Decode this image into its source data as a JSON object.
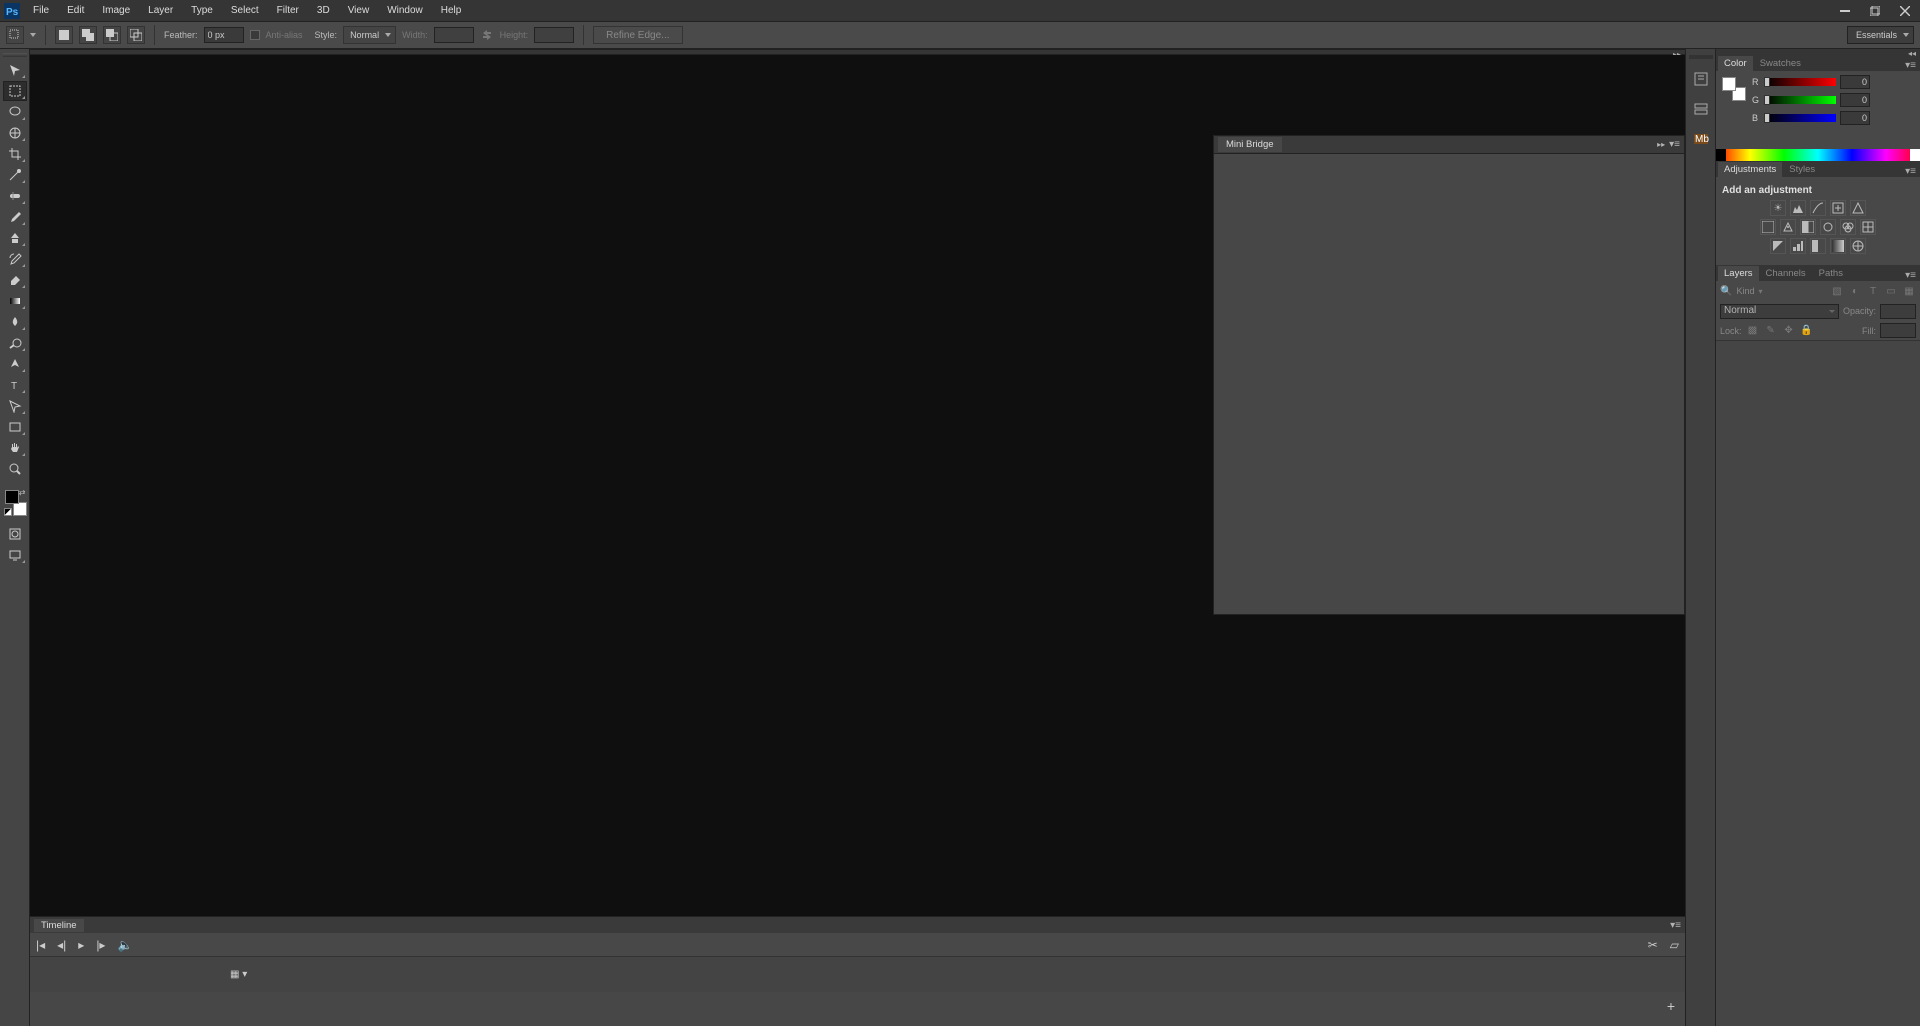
{
  "menu": {
    "file": "File",
    "edit": "Edit",
    "image": "Image",
    "layer": "Layer",
    "type": "Type",
    "select": "Select",
    "filter": "Filter",
    "threeD": "3D",
    "view": "View",
    "window": "Window",
    "help": "Help"
  },
  "options": {
    "feather_label": "Feather:",
    "feather_value": "0 px",
    "antialias_label": "Anti-alias",
    "style_label": "Style:",
    "style_value": "Normal",
    "width_label": "Width:",
    "height_label": "Height:",
    "refine_label": "Refine Edge...",
    "workspace": "Essentials"
  },
  "mini_bridge": {
    "title": "Mini Bridge"
  },
  "timeline": {
    "title": "Timeline"
  },
  "color_panel": {
    "tab_color": "Color",
    "tab_swatches": "Swatches",
    "r_label": "R",
    "g_label": "G",
    "b_label": "B",
    "r_val": "0",
    "g_val": "0",
    "b_val": "0"
  },
  "adjust_panel": {
    "tab_adjust": "Adjustments",
    "tab_styles": "Styles",
    "add_label": "Add an adjustment"
  },
  "layers_panel": {
    "tab_layers": "Layers",
    "tab_channels": "Channels",
    "tab_paths": "Paths",
    "kind_label": "Kind",
    "blend_value": "Normal",
    "opacity_label": "Opacity:",
    "lock_label": "Lock:",
    "fill_label": "Fill:"
  }
}
